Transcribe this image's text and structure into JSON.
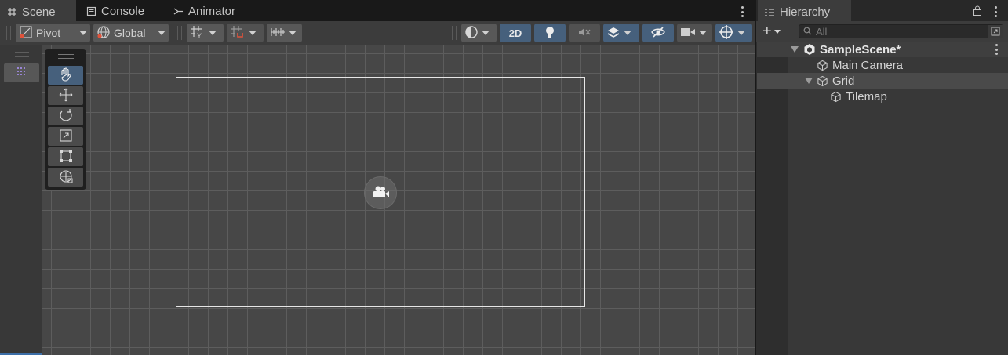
{
  "scene_tabs": [
    {
      "label": "Scene",
      "icon": "grid-icon"
    },
    {
      "label": "Console",
      "icon": "console-icon"
    },
    {
      "label": "Animator",
      "icon": "animator-icon"
    }
  ],
  "toolbar": {
    "pivot_label": "Pivot",
    "global_label": "Global",
    "mode_2d_label": "2D"
  },
  "hierarchy": {
    "tab_label": "Hierarchy",
    "search_placeholder": "All",
    "add_label": "+",
    "scene_name": "SampleScene*",
    "items": [
      {
        "label": "Main Camera"
      },
      {
        "label": "Grid"
      },
      {
        "label": "Tilemap"
      }
    ]
  },
  "colors": {
    "accent_blue": "#46607c",
    "scene_bg": "#474747",
    "grid_line": "#5d5d5d"
  }
}
